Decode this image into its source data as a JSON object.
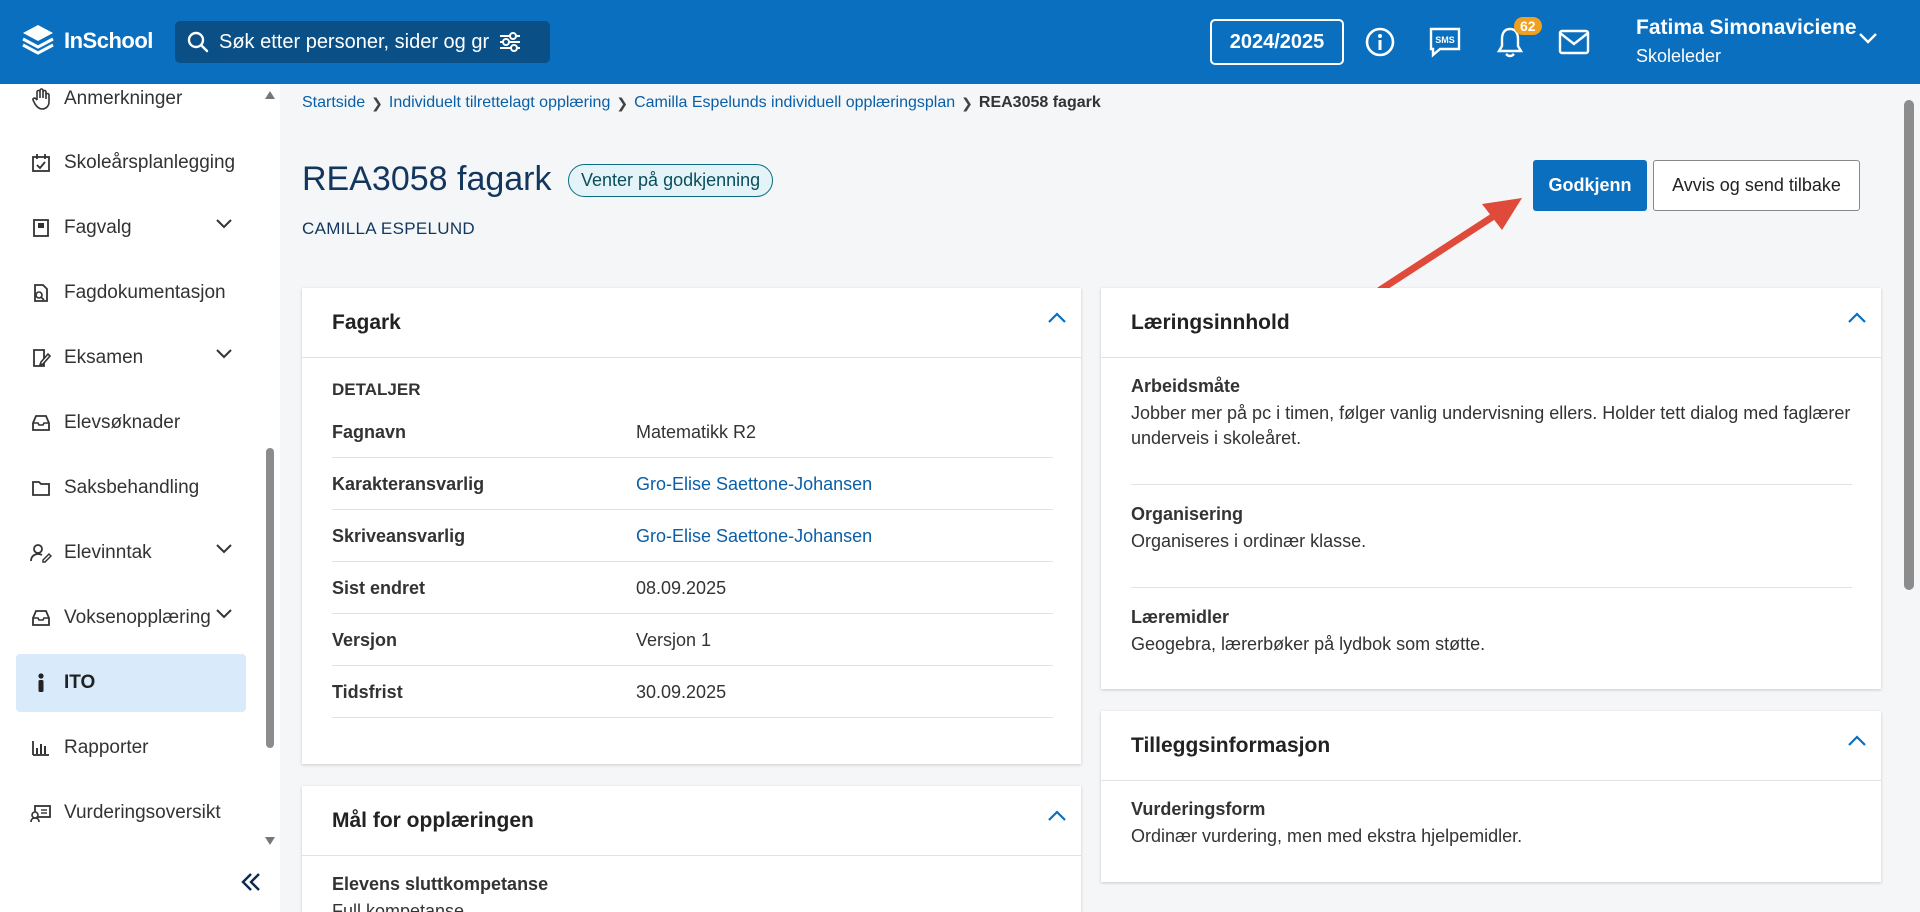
{
  "app": {
    "name": "InSchool"
  },
  "search": {
    "placeholder": "Søk etter personer, sider og grupper"
  },
  "topbar": {
    "school_year": "2024/2025",
    "notification_count": "62",
    "sms_label": "SMS"
  },
  "user": {
    "name": "Fatima Simonaviciene",
    "role": "Skoleleder"
  },
  "sidebar": {
    "items": [
      {
        "label": "Anmerkninger",
        "icon": "hand-icon"
      },
      {
        "label": "Skoleårsplanlegging",
        "icon": "calendar-check-icon"
      },
      {
        "label": "Fagvalg",
        "icon": "book-icon",
        "expandable": true
      },
      {
        "label": "Fagdokumentasjon",
        "icon": "document-search-icon"
      },
      {
        "label": "Eksamen",
        "icon": "exam-icon",
        "expandable": true
      },
      {
        "label": "Elevsøknader",
        "icon": "inbox-icon"
      },
      {
        "label": "Saksbehandling",
        "icon": "folder-icon"
      },
      {
        "label": "Elevinntak",
        "icon": "user-edit-icon",
        "expandable": true
      },
      {
        "label": "Voksenopplæring",
        "icon": "inbox-icon",
        "expandable": true
      },
      {
        "label": "ITO",
        "icon": "person-icon",
        "active": true
      },
      {
        "label": "Rapporter",
        "icon": "bar-chart-icon"
      },
      {
        "label": "Vurderingsoversikt",
        "icon": "assessment-icon"
      }
    ]
  },
  "breadcrumb": {
    "items": [
      "Startside",
      "Individuelt tilrettelagt opplæring",
      "Camilla Espelunds individuell opplæringsplan"
    ],
    "current": "REA3058 fagark"
  },
  "page": {
    "title": "REA3058 fagark",
    "status": "Venter på godkjenning",
    "student": "CAMILLA ESPELUND",
    "approve_label": "Godkjenn",
    "reject_label": "Avvis og send tilbake"
  },
  "fagark": {
    "title": "Fagark",
    "section": "DETALJER",
    "rows": [
      {
        "key": "Fagnavn",
        "value": "Matematikk R2"
      },
      {
        "key": "Karakteransvarlig",
        "value": "Gro-Elise Saettone-Johansen"
      },
      {
        "key": "Skriveansvarlig",
        "value": "Gro-Elise Saettone-Johansen"
      },
      {
        "key": "Sist endret",
        "value": "08.09.2025"
      },
      {
        "key": "Versjon",
        "value": "Versjon 1"
      },
      {
        "key": "Tidsfrist",
        "value": "30.09.2025"
      }
    ]
  },
  "maal": {
    "title": "Mål for opplæringen",
    "label": "Elevens sluttkompetanse",
    "value": "Full kompetanse"
  },
  "laeringsinnhold": {
    "title": "Læringsinnhold",
    "blocks": [
      {
        "title": "Arbeidsmåte",
        "text": "Jobber mer på pc i timen, følger vanlig undervisning ellers. Holder tett dialog med faglærer underveis i skoleåret."
      },
      {
        "title": "Organisering",
        "text": "Organiseres i ordinær klasse."
      },
      {
        "title": "Læremidler",
        "text": "Geogebra, lærerbøker på lydbok som støtte."
      }
    ]
  },
  "tillegg": {
    "title": "Tilleggsinformasjon",
    "label": "Vurderingsform",
    "text": "Ordinær vurdering, men med ekstra hjelpemidler."
  }
}
